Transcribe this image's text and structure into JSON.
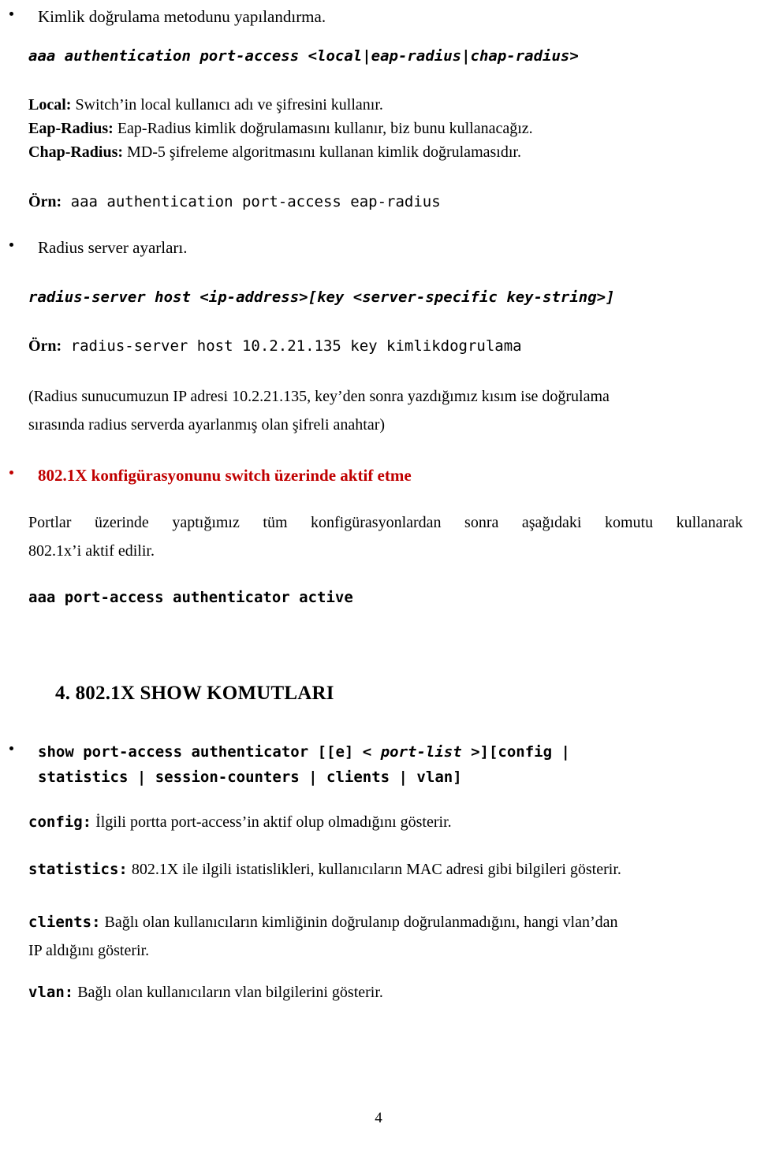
{
  "document": {
    "language": "Turkish",
    "page_number": "4",
    "accent_color": "#C00000",
    "text_color": "#000000",
    "background_color": "#FFFFFF"
  },
  "blocks": {
    "bullet_auth_method": "Kimlik doğrulama metodunu yapılandırma.",
    "cmd_aaa_auth": "aaa authentication port-access <local|eap-radius|chap-radius>",
    "defs": [
      {
        "term": "Local:",
        "desc": " Switch’in local kullanıcı adı ve şifresini kullanır."
      },
      {
        "term": "Eap-Radius:",
        "desc": " Eap-Radius kimlik doğrulamasını kullanır, biz bunu kullanacağız."
      },
      {
        "term": "Chap-Radius:",
        "desc": " MD-5 şifreleme algoritmasını kullanan kimlik doğrulamasıdır."
      }
    ],
    "orn_label_1": "Örn:",
    "orn_cmd_1": " aaa authentication port-access eap-radius",
    "bullet_radius_server": "Radius server ayarları.",
    "cmd_radius_server": "radius-server host <ip-address>[key <server-specific key-string>]",
    "orn_label_2": "Örn:",
    "orn_cmd_2": " radius-server host 10.2.21.135 key kimlikdogrulama",
    "paren_note_line1": "(Radius sunucumuzun IP adresi 10.2.21.135, key’den sonra yazdığımız kısım ise doğrulama",
    "paren_note_line2": "sırasında radius serverda ayarlanmış olan şifreli anahtar)",
    "bullet_activate_heading": "802.1X konfigürasyonunu switch üzerinde aktif etme",
    "para_portlar_line1": "Portlar üzerinde yaptığımız tüm konfigürasyonlardan sonra aşağıdaki komutu kullanarak",
    "para_portlar_line2": "802.1x’i aktif edilir.",
    "cmd_aaa_active": "aaa port-access authenticator active",
    "section_heading": "4. 802.1X SHOW KOMUTLARI",
    "show_cmd": {
      "part1": "show port-access authenticator [[e] < ",
      "italic": "port-list",
      "part2": " >][config |",
      "line2": "statistics | session-counters | clients | vlan]"
    },
    "show_options": [
      {
        "key": "config:",
        "desc": "  İlgili portta port-access’in aktif olup olmadığını gösterir."
      },
      {
        "key": "statistics:",
        "desc": "  802.1X ile ilgili istatislikleri, kullanıcıların MAC adresi gibi bilgileri gösterir."
      },
      {
        "key": "clients:",
        "desc": " Bağlı olan kullanıcıların kimliğinin doğrulanıp doğrulanmadığını, hangi vlan’dan",
        "desc2": "IP aldığını gösterir."
      },
      {
        "key": "vlan:",
        "desc": " Bağlı olan kullanıcıların vlan bilgilerini gösterir."
      }
    ]
  }
}
